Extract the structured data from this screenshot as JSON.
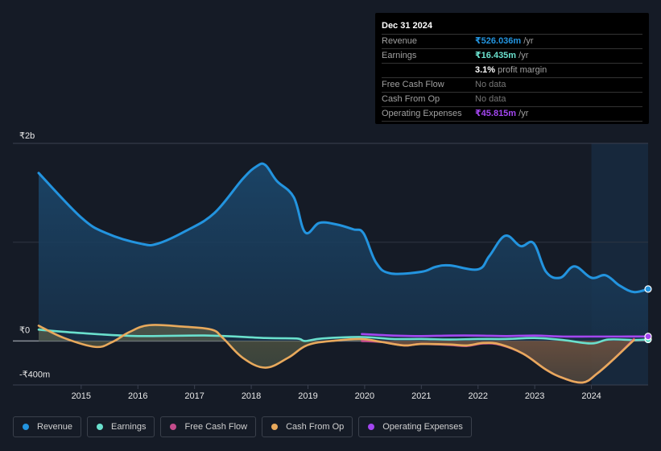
{
  "tooltip": {
    "date": "Dec 31 2024",
    "rows": [
      {
        "label": "Revenue",
        "value": "₹526.036m",
        "unit": " /yr",
        "color": "#2394df"
      },
      {
        "label": "Earnings",
        "value": "₹16.435m",
        "unit": " /yr",
        "color": "#6ae0cd"
      },
      {
        "label": "",
        "value": "3.1%",
        "unit": " profit margin",
        "color": "#ffffff"
      },
      {
        "label": "Free Cash Flow",
        "value": "No data",
        "unit": "",
        "color": "#777777"
      },
      {
        "label": "Cash From Op",
        "value": "No data",
        "unit": "",
        "color": "#777777"
      },
      {
        "label": "Operating Expenses",
        "value": "₹45.815m",
        "unit": " /yr",
        "color": "#a346f0"
      }
    ]
  },
  "legend": [
    {
      "label": "Revenue",
      "color": "#2394df"
    },
    {
      "label": "Earnings",
      "color": "#6ae0cd"
    },
    {
      "label": "Free Cash Flow",
      "color": "#c44c8c"
    },
    {
      "label": "Cash From Op",
      "color": "#e8a95c"
    },
    {
      "label": "Operating Expenses",
      "color": "#a346f0"
    }
  ],
  "chart_data": {
    "type": "area",
    "title": "",
    "xlabel": "",
    "ylabel": "",
    "ylim": [
      -445,
      2000
    ],
    "xlim": [
      2014.25,
      2025.0
    ],
    "y_ticks": [
      {
        "value": 2000,
        "label": "₹2b"
      },
      {
        "value": 0,
        "label": "₹0"
      },
      {
        "value": -400,
        "label": "-₹400m"
      }
    ],
    "x_ticks": [
      2015,
      2016,
      2017,
      2018,
      2019,
      2020,
      2021,
      2022,
      2023,
      2024
    ],
    "highlight_from": 2024.0,
    "grid": true,
    "legend_position": "bottom-left",
    "series": [
      {
        "name": "Revenue",
        "color": "#2394df",
        "points": [
          [
            2014.25,
            1700
          ],
          [
            2015.0,
            1250
          ],
          [
            2015.45,
            1090
          ],
          [
            2016.05,
            985
          ],
          [
            2016.35,
            985
          ],
          [
            2016.85,
            1115
          ],
          [
            2017.35,
            1295
          ],
          [
            2017.85,
            1640
          ],
          [
            2018.1,
            1770
          ],
          [
            2018.25,
            1780
          ],
          [
            2018.45,
            1620
          ],
          [
            2018.75,
            1455
          ],
          [
            2018.95,
            1100
          ],
          [
            2019.2,
            1195
          ],
          [
            2019.5,
            1180
          ],
          [
            2019.8,
            1130
          ],
          [
            2019.98,
            1090
          ],
          [
            2020.2,
            795
          ],
          [
            2020.45,
            685
          ],
          [
            2021.0,
            700
          ],
          [
            2021.25,
            750
          ],
          [
            2021.5,
            765
          ],
          [
            2022.0,
            725
          ],
          [
            2022.2,
            860
          ],
          [
            2022.48,
            1065
          ],
          [
            2022.75,
            960
          ],
          [
            2022.98,
            990
          ],
          [
            2023.2,
            700
          ],
          [
            2023.45,
            640
          ],
          [
            2023.7,
            755
          ],
          [
            2024.0,
            640
          ],
          [
            2024.25,
            665
          ],
          [
            2024.5,
            560
          ],
          [
            2024.75,
            495
          ],
          [
            2025.0,
            526
          ]
        ]
      },
      {
        "name": "Earnings",
        "color": "#6ae0cd",
        "points": [
          [
            2014.25,
            115
          ],
          [
            2015.0,
            80
          ],
          [
            2016.0,
            50
          ],
          [
            2017.25,
            55
          ],
          [
            2018.25,
            30
          ],
          [
            2018.8,
            25
          ],
          [
            2018.95,
            0
          ],
          [
            2019.25,
            25
          ],
          [
            2019.95,
            40
          ],
          [
            2020.5,
            20
          ],
          [
            2021.0,
            20
          ],
          [
            2021.5,
            15
          ],
          [
            2022.0,
            20
          ],
          [
            2022.5,
            20
          ],
          [
            2023.0,
            30
          ],
          [
            2023.5,
            10
          ],
          [
            2024.0,
            -25
          ],
          [
            2024.3,
            15
          ],
          [
            2024.75,
            10
          ],
          [
            2025.0,
            16
          ]
        ]
      },
      {
        "name": "Free Cash Flow",
        "color": "#c44c8c",
        "points": [
          [
            2019.95,
            0
          ],
          [
            2020.3,
            -10
          ],
          [
            2020.7,
            -45
          ],
          [
            2021.0,
            -30
          ],
          [
            2021.5,
            -40
          ],
          [
            2021.8,
            -50
          ],
          [
            2022.1,
            -25
          ],
          [
            2022.4,
            -40
          ],
          [
            2022.8,
            -130
          ],
          [
            2023.2,
            -290
          ],
          [
            2023.5,
            -375
          ],
          [
            2023.85,
            -420
          ],
          [
            2024.1,
            -330
          ],
          [
            2024.4,
            -180
          ],
          [
            2024.75,
            20
          ]
        ]
      },
      {
        "name": "Cash From Op",
        "color": "#e8a95c",
        "points": [
          [
            2014.25,
            155
          ],
          [
            2014.7,
            30
          ],
          [
            2015.25,
            -60
          ],
          [
            2015.55,
            -10
          ],
          [
            2015.85,
            90
          ],
          [
            2016.2,
            160
          ],
          [
            2016.8,
            145
          ],
          [
            2017.3,
            115
          ],
          [
            2017.5,
            30
          ],
          [
            2017.85,
            -170
          ],
          [
            2018.25,
            -270
          ],
          [
            2018.65,
            -170
          ],
          [
            2019.0,
            -40
          ],
          [
            2019.5,
            5
          ],
          [
            2019.95,
            20
          ],
          [
            2020.3,
            -10
          ],
          [
            2020.7,
            -45
          ],
          [
            2021.0,
            -30
          ],
          [
            2021.5,
            -35
          ],
          [
            2021.8,
            -45
          ],
          [
            2022.1,
            -20
          ],
          [
            2022.4,
            -35
          ],
          [
            2022.8,
            -130
          ],
          [
            2023.2,
            -290
          ],
          [
            2023.5,
            -375
          ],
          [
            2023.85,
            -420
          ],
          [
            2024.1,
            -330
          ],
          [
            2024.4,
            -180
          ],
          [
            2024.75,
            10
          ]
        ]
      },
      {
        "name": "Operating Expenses",
        "color": "#a346f0",
        "points": [
          [
            2019.95,
            70
          ],
          [
            2020.5,
            55
          ],
          [
            2021.0,
            50
          ],
          [
            2021.5,
            55
          ],
          [
            2022.0,
            55
          ],
          [
            2022.5,
            50
          ],
          [
            2023.0,
            55
          ],
          [
            2023.5,
            45
          ],
          [
            2024.0,
            45
          ],
          [
            2024.5,
            45
          ],
          [
            2025.0,
            46
          ]
        ]
      }
    ]
  }
}
